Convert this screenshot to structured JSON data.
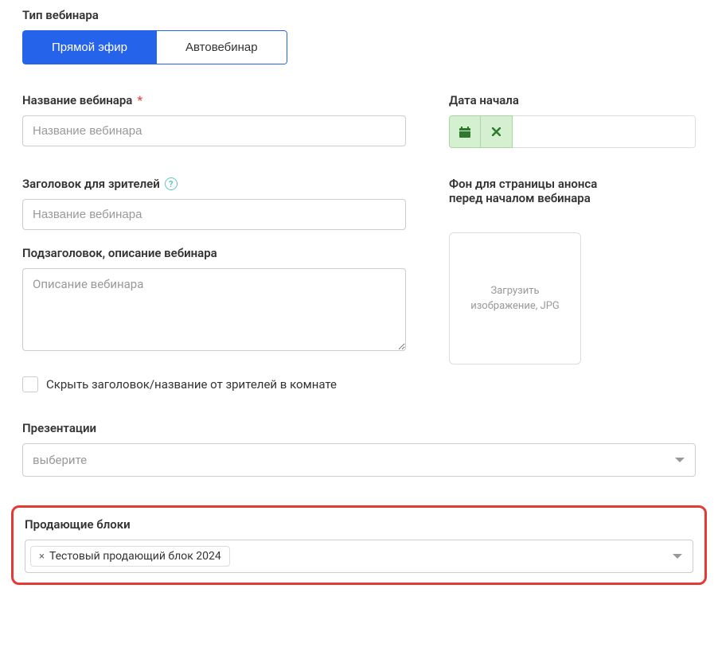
{
  "webinarType": {
    "label": "Тип вебинара",
    "live": "Прямой эфир",
    "auto": "Автовебинар"
  },
  "webinarName": {
    "label": "Название вебинара",
    "required": "*",
    "placeholder": "Название вебинара"
  },
  "startDate": {
    "label": "Дата начала"
  },
  "viewerTitle": {
    "label": "Заголовок для зрителей",
    "placeholder": "Название вебинара"
  },
  "subtitle": {
    "label": "Подзаголовок, описание вебинара",
    "placeholder": "Описание вебинара"
  },
  "background": {
    "label": "Фон для страницы анонса перед началом вебинара",
    "uploadText": "Загрузить изображение, JPG"
  },
  "hideTitle": {
    "label": "Скрыть заголовок/название от зрителей в комнате"
  },
  "presentations": {
    "label": "Презентации",
    "placeholder": "выберите"
  },
  "sellingBlocks": {
    "label": "Продающие блоки",
    "selected": "Тестовый продающий блок 2024"
  }
}
